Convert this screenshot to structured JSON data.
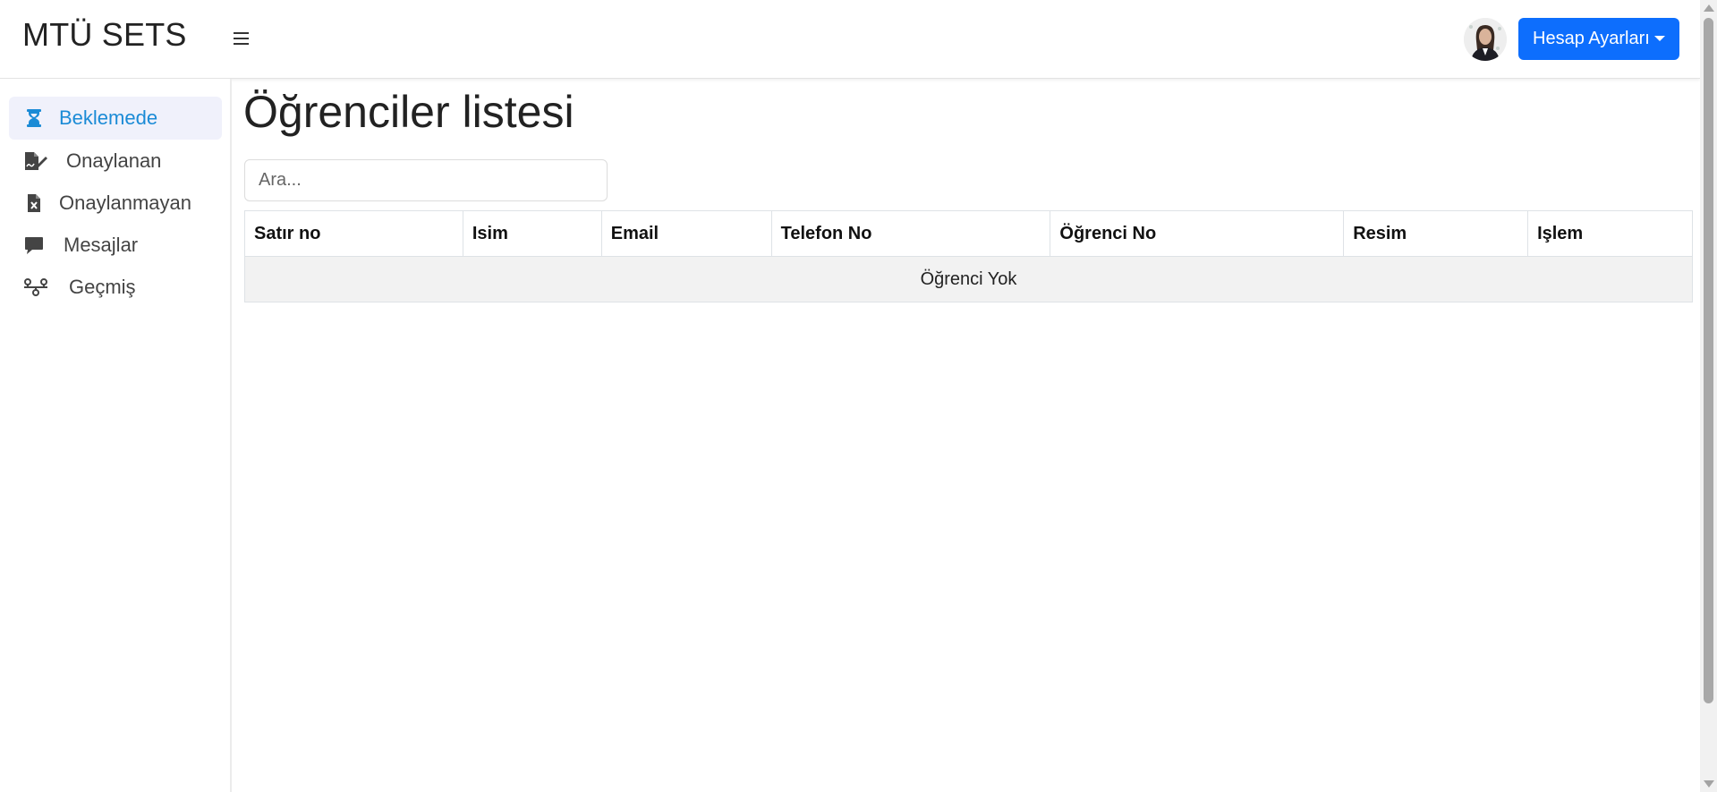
{
  "header": {
    "brand": "MTÜ SETS",
    "account_button": "Hesap Ayarları"
  },
  "sidebar": {
    "items": [
      {
        "label": "Beklemede",
        "icon": "hourglass-icon",
        "active": true
      },
      {
        "label": "Onaylanan",
        "icon": "file-signature-icon",
        "active": false
      },
      {
        "label": "Onaylanmayan",
        "icon": "file-excel-icon",
        "active": false
      },
      {
        "label": "Mesajlar",
        "icon": "comment-icon",
        "active": false
      },
      {
        "label": "Geçmiş",
        "icon": "timeline-icon",
        "active": false
      }
    ]
  },
  "main": {
    "title": "Öğrenciler listesi",
    "search_placeholder": "Ara...",
    "table": {
      "columns": [
        "Satır no",
        "Isim",
        "Email",
        "Telefon No",
        "Öğrenci No",
        "Resim",
        "Işlem"
      ],
      "empty_message": "Öğrenci Yok"
    }
  },
  "colors": {
    "accent": "#0d6efd",
    "active_nav_text": "#1b8bd6",
    "active_nav_bg": "#f0f1fb"
  }
}
